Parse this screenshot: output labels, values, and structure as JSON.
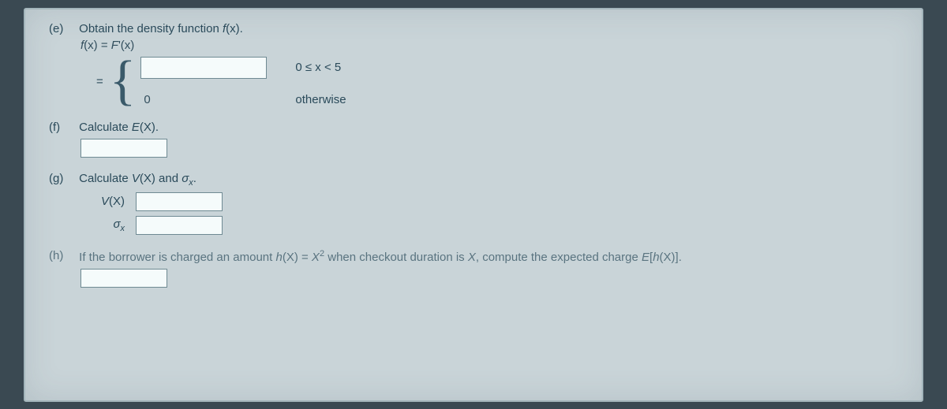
{
  "e": {
    "label": "(e)",
    "prompt_pre": "Obtain the density function ",
    "prompt_fn": "f",
    "prompt_arg": "(x).",
    "equation_lhs_f": "f",
    "equation_lhs_arg": "(x) = ",
    "equation_rhs_F": "F",
    "equation_rhs_prime_arg": "'(x)",
    "equals": "=",
    "case1_cond": "0 ≤ x < 5",
    "case2_value": "0",
    "case2_cond": "otherwise"
  },
  "f": {
    "label": "(f)",
    "prompt_pre": "Calculate ",
    "prompt_E": "E",
    "prompt_arg": "(X)."
  },
  "g": {
    "label": "(g)",
    "prompt_pre": "Calculate ",
    "prompt_V": "V",
    "prompt_vx": "(X) and ",
    "sigma": "σ",
    "sigma_sub": "x",
    "period": ".",
    "row1_V": "V",
    "row1_arg": "(X)",
    "row2_sigma": "σ",
    "row2_sub": "x"
  },
  "h": {
    "label": "(h)",
    "t1": "If the borrower is charged an amount ",
    "h_fn": "h",
    "h_arg": "(X) = ",
    "x": "X",
    "sq": "2",
    "t2": " when checkout duration is ",
    "Xvar": "X",
    "t3": ", compute the expected charge ",
    "E": "E",
    "br_open": "[",
    "h2": "h",
    "h2_arg": "(X)",
    "br_close": "]."
  }
}
